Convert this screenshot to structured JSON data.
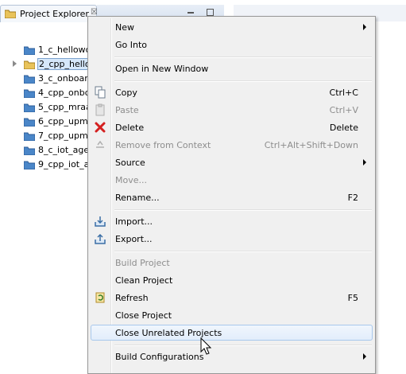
{
  "view": {
    "title": "Project Explorer",
    "close_glyph": "☒"
  },
  "tree": {
    "items": [
      {
        "label": "1_c_hellowo",
        "selected": false,
        "expandable": false
      },
      {
        "label": "2_cpp_hello",
        "selected": true,
        "expandable": true
      },
      {
        "label": "3_c_onboar",
        "selected": false,
        "expandable": false
      },
      {
        "label": "4_cpp_onbo",
        "selected": false,
        "expandable": false
      },
      {
        "label": "5_cpp_mraa",
        "selected": false,
        "expandable": false
      },
      {
        "label": "6_cpp_upm",
        "selected": false,
        "expandable": false
      },
      {
        "label": "7_cpp_upm",
        "selected": false,
        "expandable": false
      },
      {
        "label": "8_c_iot_age",
        "selected": false,
        "expandable": false
      },
      {
        "label": "9_cpp_iot_a",
        "selected": false,
        "expandable": false
      }
    ]
  },
  "menu": {
    "new": {
      "label": "New"
    },
    "go_into": {
      "label": "Go Into"
    },
    "open_new_window": {
      "label": "Open in New Window"
    },
    "copy": {
      "label": "Copy",
      "accel": "Ctrl+C"
    },
    "paste": {
      "label": "Paste",
      "accel": "Ctrl+V"
    },
    "delete": {
      "label": "Delete",
      "accel": "Delete"
    },
    "remove_context": {
      "label": "Remove from Context",
      "accel": "Ctrl+Alt+Shift+Down"
    },
    "source": {
      "label": "Source"
    },
    "move": {
      "label": "Move..."
    },
    "rename": {
      "label": "Rename...",
      "accel": "F2"
    },
    "import": {
      "label": "Import..."
    },
    "export": {
      "label": "Export..."
    },
    "build_project": {
      "label": "Build Project"
    },
    "clean_project": {
      "label": "Clean Project"
    },
    "refresh": {
      "label": "Refresh",
      "accel": "F5"
    },
    "close_project": {
      "label": "Close Project"
    },
    "close_unrelated": {
      "label": "Close Unrelated Projects"
    },
    "build_configs": {
      "label": "Build Configurations"
    }
  },
  "colors": {
    "folder": "#4a86c8",
    "hover_border": "#a8c8ec",
    "selection": "#d6e8fb",
    "delete_red": "#d42020"
  }
}
